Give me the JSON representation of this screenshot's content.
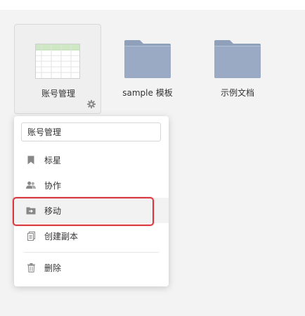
{
  "files": [
    {
      "name": "账号管理",
      "type": "sheet",
      "selected": true
    },
    {
      "name": "sample 模板",
      "type": "folder",
      "selected": false
    },
    {
      "name": "示例文档",
      "type": "folder",
      "selected": false
    }
  ],
  "menu": {
    "rename_value": "账号管理",
    "items": [
      {
        "label": "标星",
        "icon": "bookmark-icon"
      },
      {
        "label": "协作",
        "icon": "people-icon"
      },
      {
        "label": "移动",
        "icon": "move-folder-icon"
      },
      {
        "label": "创建副本",
        "icon": "copy-icon"
      },
      {
        "label": "删除",
        "icon": "trash-icon"
      }
    ]
  },
  "colors": {
    "folder": "#9aaac4",
    "sheet_header": "#cfe8c4",
    "highlight": "#d9393e",
    "hover_bg": "#f2f2f2"
  }
}
